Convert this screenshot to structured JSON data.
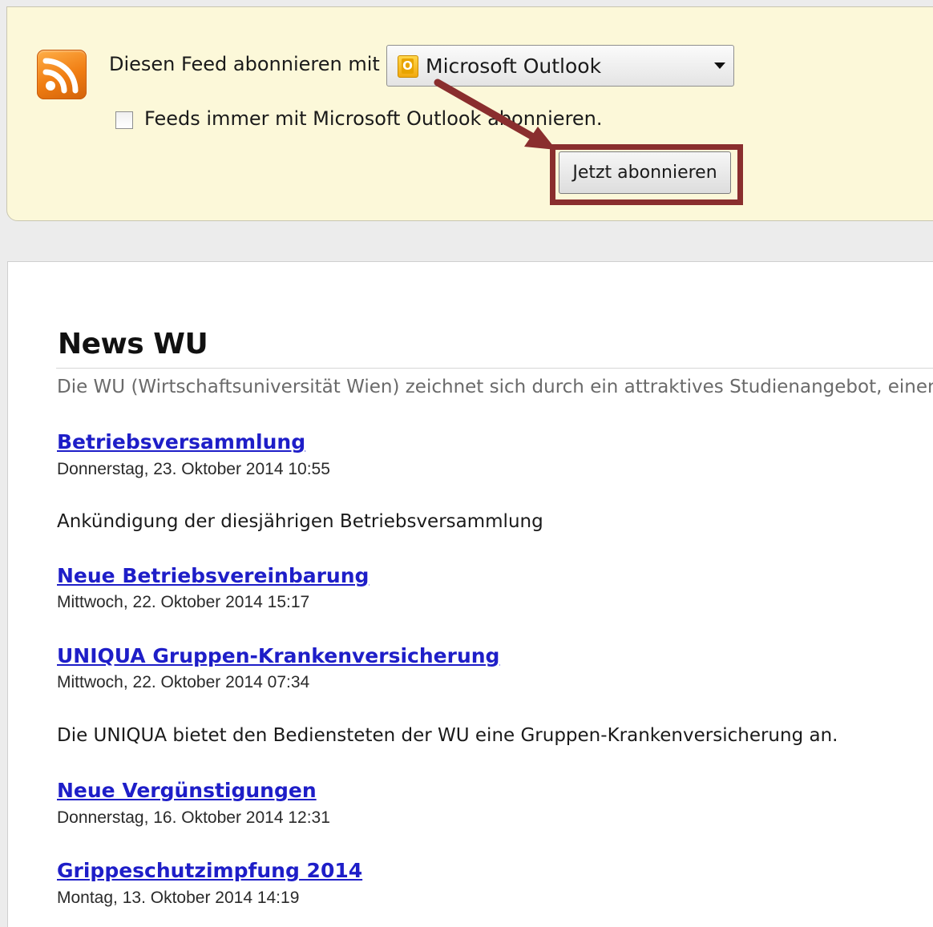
{
  "subscribe_bar": {
    "label": "Diesen Feed abonnieren mit",
    "reader_selected": "Microsoft Outlook",
    "always_label": "Feeds immer mit Microsoft Outlook abonnieren.",
    "always_checked": false,
    "button_label": "Jetzt abonnieren",
    "annotation_color": "#8a2e2e"
  },
  "feed": {
    "title": "News WU",
    "description": "Die WU (Wirtschaftsuniversität Wien) zeichnet sich durch ein attraktives Studienangebot, einen",
    "items": [
      {
        "title": "Betriebsversammlung",
        "date": "Donnerstag, 23. Oktober 2014 10:55",
        "summary": "Ankündigung der diesjährigen Betriebsversammlung"
      },
      {
        "title": "Neue Betriebsvereinbarung",
        "date": "Mittwoch, 22. Oktober 2014 15:17",
        "summary": ""
      },
      {
        "title": "UNIQUA Gruppen-Krankenversicherung",
        "date": "Mittwoch, 22. Oktober 2014 07:34",
        "summary": "Die UNIQUA bietet den Bediensteten der WU eine Gruppen-Krankenversicherung an."
      },
      {
        "title": "Neue Vergünstigungen",
        "date": "Donnerstag, 16. Oktober 2014 12:31",
        "summary": ""
      },
      {
        "title": "Grippeschutzimpfung 2014",
        "date": "Montag, 13. Oktober 2014 14:19",
        "summary": ""
      }
    ]
  },
  "icons": {
    "feed": "rss-icon",
    "reader": "outlook-icon",
    "dropdown": "chevron-down-icon"
  }
}
